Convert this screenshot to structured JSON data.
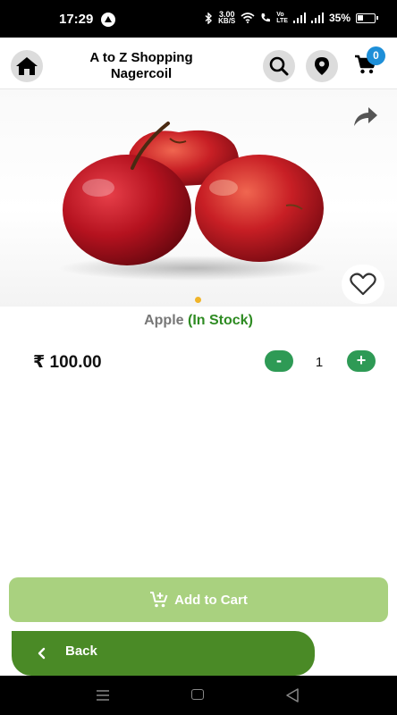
{
  "status_bar": {
    "time": "17:29",
    "net_speed_value": "3.00",
    "net_speed_unit": "KB/S",
    "volte_top": "Vo",
    "volte_bottom": "LTE",
    "battery": "35%"
  },
  "header": {
    "title_line1": "A to Z Shopping",
    "title_line2": "Nagercoil",
    "cart_count": "0",
    "icons": [
      "home-icon",
      "search-icon",
      "location-pin-icon",
      "cart-icon"
    ]
  },
  "product": {
    "name": "Apple",
    "stock_status": "(In Stock)",
    "price": "₹ 100.00",
    "quantity": "1",
    "qty_minus_label": "-",
    "qty_plus_label": "+",
    "image_subject": "red-apples",
    "carousel_index": 1,
    "carousel_total": 1
  },
  "actions": {
    "add_to_cart_label": "Add to Cart",
    "back_label": "Back"
  },
  "colors": {
    "accent_green": "#2e9a55",
    "stock_green": "#2e8b22",
    "add_to_cart_bg": "#a9d17f",
    "back_bg": "#4a8a26",
    "badge_blue": "#1e8fd8",
    "carousel_dot": "#f0b429"
  }
}
